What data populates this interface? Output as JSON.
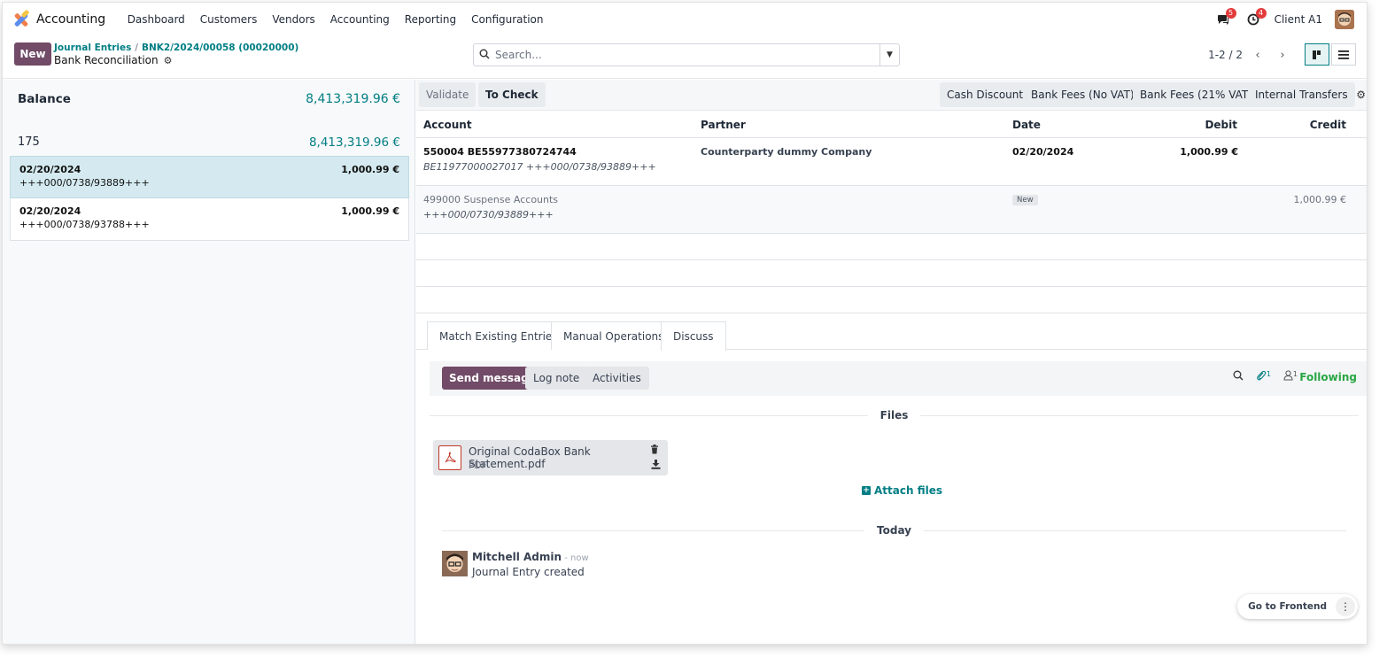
{
  "navbar": {
    "app_name": "Accounting",
    "menu": [
      "Dashboard",
      "Customers",
      "Vendors",
      "Accounting",
      "Reporting",
      "Configuration"
    ],
    "messages_count": "5",
    "activities_count": "4",
    "company": "Client A1"
  },
  "control": {
    "new_label": "New",
    "breadcrumb_parent": "Journal Entries",
    "breadcrumb_current": "BNK2/2024/00058 (00020000)",
    "title": "Bank Reconciliation",
    "search_placeholder": "Search...",
    "pager": "1-2 / 2"
  },
  "left": {
    "balance_label": "Balance",
    "balance_amount": "8,413,319.96 €",
    "count": "175",
    "count_amount": "8,413,319.96 €",
    "lines": [
      {
        "date": "02/20/2024",
        "ref": "+++000/0738/93889+++",
        "amount": "1,000.99 €",
        "selected": true
      },
      {
        "date": "02/20/2024",
        "ref": "+++000/0738/93788+++",
        "amount": "1,000.99 €",
        "selected": false
      }
    ]
  },
  "actions": {
    "validate": "Validate",
    "to_check": "To Check",
    "models": [
      "Cash Discount",
      "Bank Fees (No VAT)",
      "Bank Fees (21% VAT)",
      "Internal Transfers"
    ]
  },
  "table": {
    "headers": {
      "account": "Account",
      "partner": "Partner",
      "date": "Date",
      "debit": "Debit",
      "credit": "Credit"
    },
    "rows": [
      {
        "account": "550004 BE55977380724744",
        "account_sub": "BE11977000027017 +++000/0738/93889+++",
        "partner": "Counterparty dummy Company",
        "date": "02/20/2024",
        "debit": "1,000.99 €",
        "credit": ""
      },
      {
        "account": "499000 Suspense Accounts",
        "account_sub": "+++000/0730/93889+++",
        "partner": "",
        "tag": "New",
        "debit": "",
        "credit": "1,000.99 €"
      }
    ]
  },
  "tabs": [
    "Match Existing Entries",
    "Manual Operations",
    "Discuss"
  ],
  "chatter": {
    "send_message": "Send message",
    "log_note": "Log note",
    "activities": "Activities",
    "attachments_count": "1",
    "followers_count": "1",
    "following": "Following",
    "files_title": "Files",
    "attachment_name": "Original CodaBox Bank Statement.pdf",
    "attachment_type": "PDF",
    "attach_files": "Attach files",
    "today_title": "Today",
    "message_author": "Mitchell Admin",
    "message_time": " - now",
    "message_body": "Journal Entry created"
  },
  "footer": {
    "go_frontend": "Go to Frontend"
  }
}
